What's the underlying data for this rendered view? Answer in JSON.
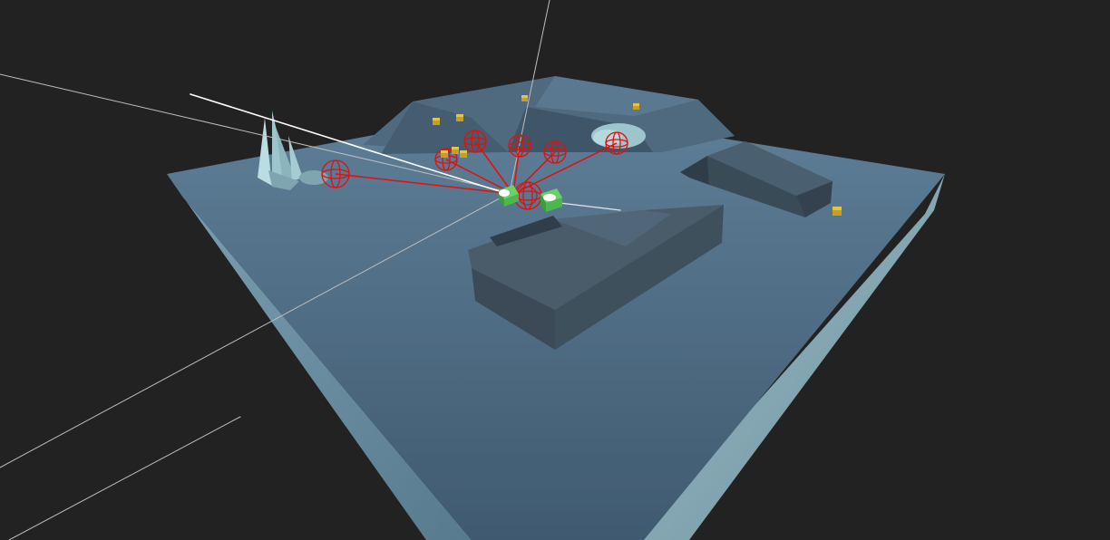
{
  "scene": {
    "background_color": "#222222",
    "ground_top_color": "#5a7a93",
    "ground_side_left_color": "#6f8fa3",
    "ground_side_right_color": "#86a7b5",
    "building_color": "#3e4e5b",
    "gizmo_color": "#e01010",
    "ray_color": "#d0d0d0",
    "pickup_color": "#c8a020",
    "agent_color": "#4fbf4f",
    "crystal_color": "#a9cfd6"
  },
  "objects": {
    "gizmo_sphere_count": 8,
    "pickup_count": 9,
    "agent_count": 2,
    "building_count": 3
  }
}
